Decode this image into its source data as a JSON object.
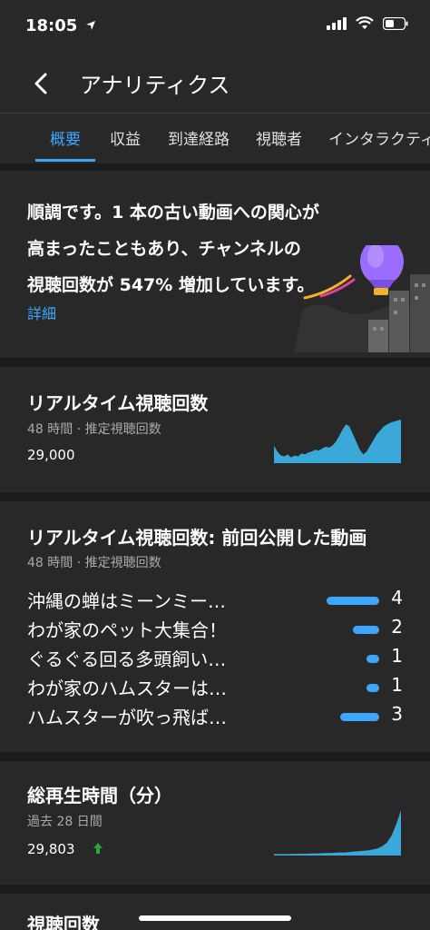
{
  "status_bar": {
    "time": "18:05"
  },
  "header": {
    "title": "アナリティクス"
  },
  "tabs": [
    {
      "label": "概要",
      "active": true
    },
    {
      "label": "収益",
      "active": false
    },
    {
      "label": "到達経路",
      "active": false
    },
    {
      "label": "視聴者",
      "active": false
    },
    {
      "label": "インタラクティ",
      "active": false
    }
  ],
  "hero": {
    "lines": [
      "順調です。1 本の古い動画への関心が",
      "高まったこともあり、チャンネルの",
      "視聴回数が 547% 増加しています。"
    ],
    "link": "詳細"
  },
  "realtime": {
    "title": "リアルタイム視聴回数",
    "subtitle": "48 時間 · 推定視聴回数",
    "value": "29,000",
    "chart_data": {
      "type": "area",
      "values": [
        18,
        12,
        8,
        7,
        9,
        6,
        8,
        7,
        10,
        9,
        11,
        12,
        14,
        13,
        15,
        17,
        16,
        18,
        22,
        28,
        35,
        40,
        38,
        30,
        22,
        14,
        9,
        12,
        18,
        24,
        30,
        34,
        38,
        40,
        42,
        43,
        44,
        45
      ]
    }
  },
  "latest_video": {
    "title": "リアルタイム視聴回数: 前回公開した動画",
    "subtitle": "48 時間 · 推定視聴回数",
    "chart_data": {
      "type": "bar",
      "categories": [
        "沖縄の蝉はミーンミー…",
        "わが家のペット大集合！",
        "ぐるぐる回る多頭飼い…",
        "わが家のハムスターは…",
        "ハムスターが吹っ飛ば…"
      ],
      "values": [
        4,
        2,
        1,
        1,
        3
      ]
    }
  },
  "watch_time": {
    "title": "総再生時間（分）",
    "subtitle": "過去 28 日間",
    "value": "29,803",
    "trend_icon": "arrow-up-icon",
    "trend_color": "#2ba640",
    "chart_data": {
      "type": "area",
      "values": [
        1,
        1,
        1,
        1,
        1.2,
        1.1,
        1.3,
        1.2,
        1.5,
        1.4,
        1.6,
        1.8,
        1.7,
        2,
        2.2,
        2.1,
        2.5,
        2.8,
        3,
        3.3,
        3.6,
        4.2,
        5,
        6.5,
        9,
        14,
        22,
        32
      ]
    }
  },
  "views": {
    "title": "視聴回数"
  },
  "colors": {
    "accent": "#3ea6ff",
    "chart": "#3aa8d8",
    "positive": "#2ba640"
  }
}
